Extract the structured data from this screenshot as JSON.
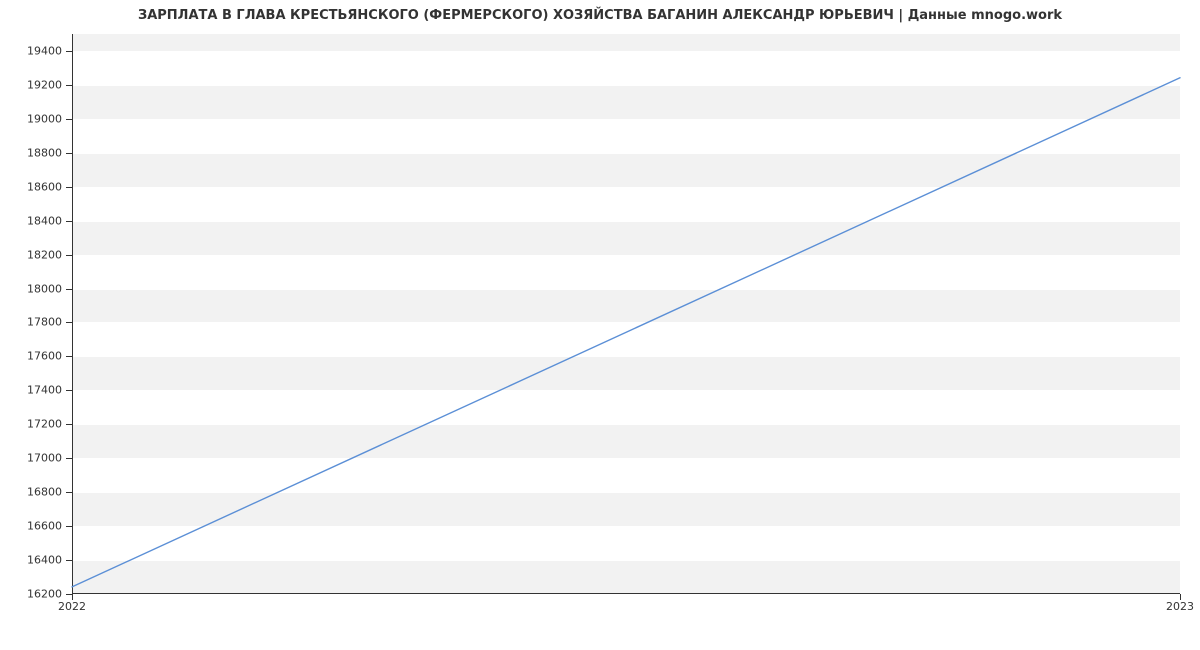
{
  "chart_data": {
    "type": "line",
    "title": "ЗАРПЛАТА В ГЛАВА КРЕСТЬЯНСКОГО (ФЕРМЕРСКОГО) ХОЗЯЙСТВА БАГАНИН АЛЕКСАНДР ЮРЬЕВИЧ | Данные mnogo.work",
    "x": [
      2022,
      2023
    ],
    "values": [
      16242,
      19242
    ],
    "x_ticks": [
      2022,
      2023
    ],
    "y_ticks": [
      16200,
      16400,
      16600,
      16800,
      17000,
      17200,
      17400,
      17600,
      17800,
      18000,
      18200,
      18400,
      18600,
      18800,
      19000,
      19200,
      19400
    ],
    "xlim": [
      2022,
      2023
    ],
    "ylim": [
      16200,
      19500
    ],
    "xlabel": "",
    "ylabel": "",
    "line_color": "#5b8fd6",
    "band_color": "#f2f2f2"
  }
}
